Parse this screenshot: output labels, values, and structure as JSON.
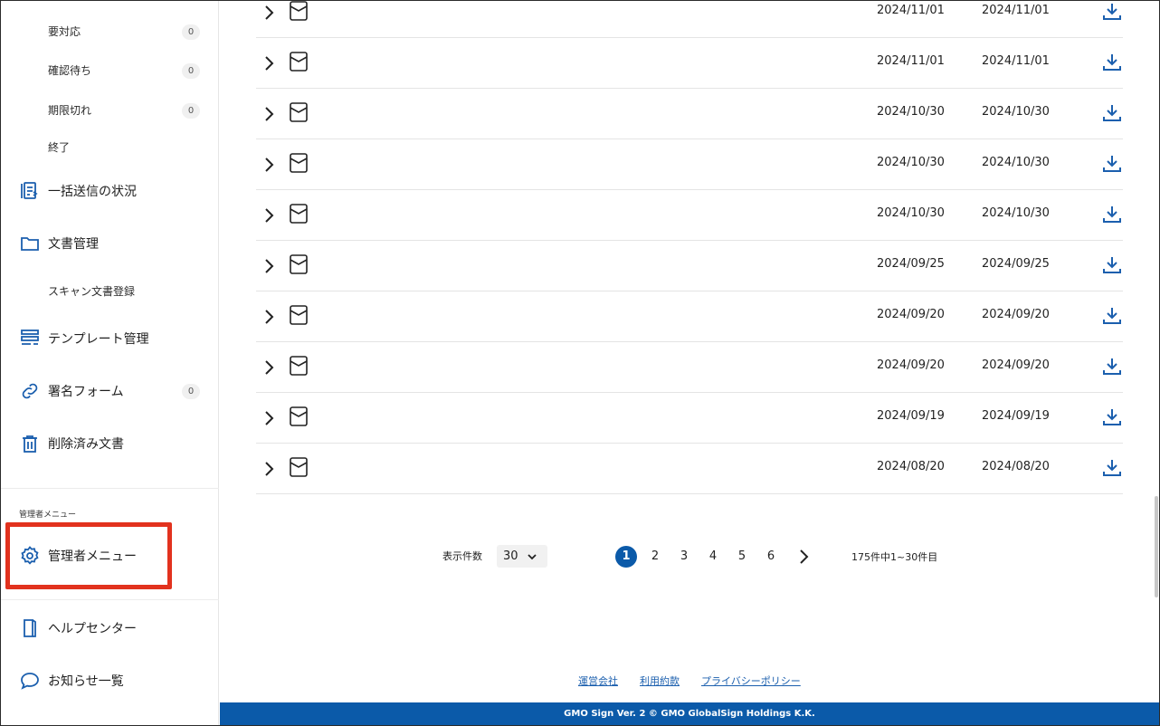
{
  "sidebar": {
    "sub_items": [
      {
        "label": "要対応",
        "count": "0"
      },
      {
        "label": "確認待ち",
        "count": "0"
      },
      {
        "label": "期限切れ",
        "count": "0"
      },
      {
        "label": "終了"
      }
    ],
    "bulk_send": {
      "label": "一括送信の状況",
      "icon": "bulk-send-icon"
    },
    "documents": {
      "label": "文書管理",
      "icon": "folder-icon"
    },
    "scan_register": {
      "label": "スキャン文書登録"
    },
    "templates": {
      "label": "テンプレート管理",
      "icon": "template-icon"
    },
    "sign_form": {
      "label": "署名フォーム",
      "icon": "link-icon",
      "count": "0"
    },
    "deleted": {
      "label": "削除済み文書",
      "icon": "trash-icon"
    },
    "admin_section_label": "管理者メニュー",
    "admin_menu": {
      "label": "管理者メニュー",
      "icon": "gear-icon"
    },
    "help_center": {
      "label": "ヘルプセンター",
      "icon": "book-icon"
    },
    "notices": {
      "label": "お知らせ一覧",
      "icon": "chat-bubble-icon"
    }
  },
  "table": {
    "rows": [
      {
        "date1": "2024/11/01",
        "date2": "2024/11/01"
      },
      {
        "date1": "2024/11/01",
        "date2": "2024/11/01"
      },
      {
        "date1": "2024/10/30",
        "date2": "2024/10/30"
      },
      {
        "date1": "2024/10/30",
        "date2": "2024/10/30"
      },
      {
        "date1": "2024/10/30",
        "date2": "2024/10/30"
      },
      {
        "date1": "2024/09/25",
        "date2": "2024/09/25"
      },
      {
        "date1": "2024/09/20",
        "date2": "2024/09/20"
      },
      {
        "date1": "2024/09/20",
        "date2": "2024/09/20"
      },
      {
        "date1": "2024/09/19",
        "date2": "2024/09/19"
      },
      {
        "date1": "2024/08/20",
        "date2": "2024/08/20"
      }
    ]
  },
  "pagination": {
    "per_page_label": "表示件数",
    "per_page_value": "30",
    "pages": [
      "1",
      "2",
      "3",
      "4",
      "5",
      "6"
    ],
    "active_page": "1",
    "total": "175件中1~30件目"
  },
  "footer": {
    "links": [
      "運営会社",
      "利用約款",
      "プライバシーポリシー"
    ],
    "copyright": "GMO Sign Ver. 2 © GMO GlobalSign Holdings K.K."
  },
  "colors": {
    "accent": "#0b5aa9",
    "highlight": "#e2321e",
    "icon": "#1b5fae"
  }
}
